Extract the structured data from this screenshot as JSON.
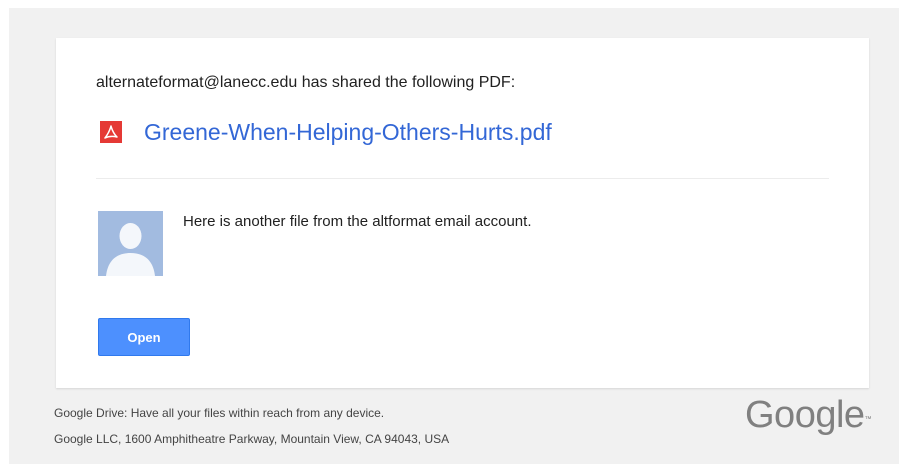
{
  "email": {
    "share_line": "alternateformat@lanecc.edu has shared the following PDF:",
    "file_name": "Greene-When-Helping-Others-Hurts.pdf",
    "file_icon": "pdf-icon",
    "message": "Here is another file from the altformat email account.",
    "open_button_label": "Open"
  },
  "footer": {
    "tagline": "Google Drive: Have all your files within reach from any device.",
    "address": "Google LLC, 1600 Amphitheatre Parkway, Mountain View, CA 94043, USA",
    "logo_text": "Google",
    "logo_mark": "™"
  },
  "colors": {
    "link": "#3367d6",
    "button": "#4d90fe",
    "pdf_red": "#e53935",
    "avatar_bg": "#a2bbe0",
    "page_bg": "#f1f1f1"
  }
}
